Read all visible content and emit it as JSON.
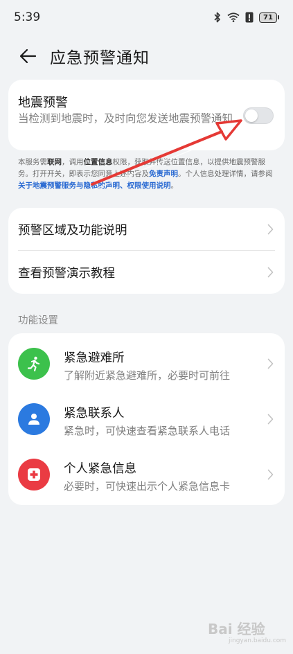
{
  "status_bar": {
    "time": "5:39",
    "battery": "71"
  },
  "header": {
    "title": "应急预警通知"
  },
  "earthquake_card": {
    "title": "地震预警",
    "description": "当检测到地震时，及时向您发送地震预警通知",
    "toggle_on": false
  },
  "notice": {
    "p1": "本服务需",
    "b1": "联网",
    "p2": "，调用",
    "b2": "位置信息",
    "p3": "权限，获取并传送位置信息，以提供地震预警服务。打开开关，即表示您同意上述内容及",
    "link1": "免责声明",
    "p4": "。个人信息处理详情，请参阅",
    "link2": "关于地震预警服务与隐私的声明、权限使用说明",
    "p5": "。"
  },
  "info_rows": [
    {
      "label": "预警区域及功能说明"
    },
    {
      "label": "查看预警演示教程"
    }
  ],
  "section": {
    "title": "功能设置"
  },
  "functions": [
    {
      "title": "紧急避难所",
      "subtitle": "了解附近紧急避难所，必要时可前往",
      "color": "#3cc14c",
      "icon": "running-person-icon"
    },
    {
      "title": "紧急联系人",
      "subtitle": "紧急时，可快速查看紧急联系人电话",
      "color": "#2b7ae0",
      "icon": "contact-person-icon"
    },
    {
      "title": "个人紧急信息",
      "subtitle": "必要时，可快速出示个人紧急信息卡",
      "color": "#ea3b43",
      "icon": "medical-cross-icon"
    }
  ],
  "watermark": {
    "text": "Bai 经验",
    "sub": "jingyan.baidu.com"
  },
  "colors": {
    "background": "#f1f3f5",
    "card": "#ffffff",
    "link": "#2a6ad2",
    "annotation_arrow": "#e53935"
  }
}
